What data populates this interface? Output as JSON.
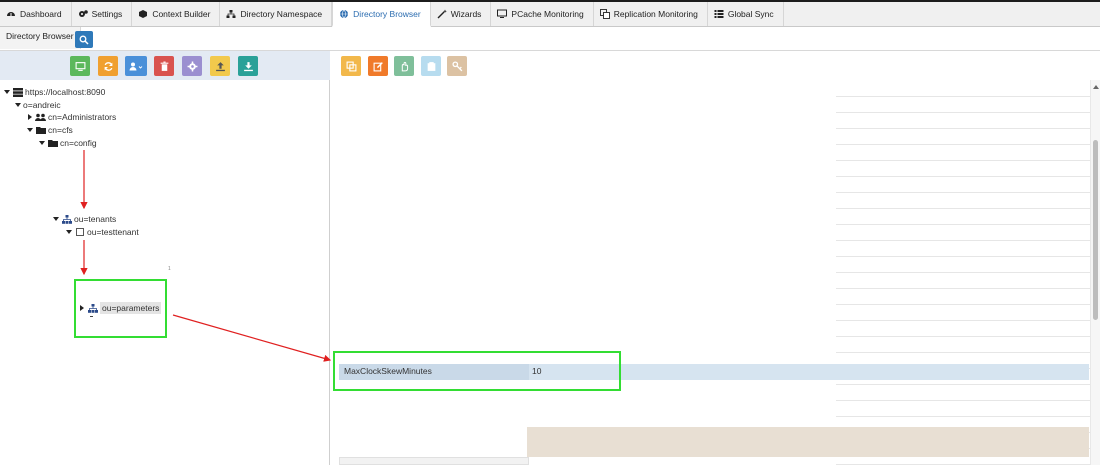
{
  "tabs": [
    {
      "label": "Dashboard",
      "icon": "dashboard-icon",
      "active": false
    },
    {
      "label": "Settings",
      "icon": "gears-icon",
      "active": false
    },
    {
      "label": "Context Builder",
      "icon": "cube-icon",
      "active": false
    },
    {
      "label": "Directory Namespace",
      "icon": "sitemap-icon",
      "active": false
    },
    {
      "label": "Directory Browser",
      "icon": "globe-icon",
      "active": true
    },
    {
      "label": "Wizards",
      "icon": "wand-icon",
      "active": false
    },
    {
      "label": "PCache Monitoring",
      "icon": "monitor-icon",
      "active": false
    },
    {
      "label": "Replication Monitoring",
      "icon": "replication-icon",
      "active": false
    },
    {
      "label": "Global Sync",
      "icon": "list-icon",
      "active": false
    }
  ],
  "subtab": {
    "label": "Directory Browser"
  },
  "left_toolbar": [
    {
      "name": "monitor-button",
      "color": "#5cb85c"
    },
    {
      "name": "refresh-button",
      "color": "#f0a030"
    },
    {
      "name": "add-user-button",
      "color": "#4a90d9"
    },
    {
      "name": "delete-button",
      "color": "#d9534f"
    },
    {
      "name": "settings-button",
      "color": "#9b8fd0"
    },
    {
      "name": "upload-button",
      "color": "#f2c94c"
    },
    {
      "name": "download-button",
      "color": "#2aa198"
    }
  ],
  "right_toolbar": [
    {
      "name": "copy-button",
      "color": "#f2b84b"
    },
    {
      "name": "edit-button",
      "color": "#f07a2a"
    },
    {
      "name": "hand-button",
      "color": "#7fbf9a"
    },
    {
      "name": "clipboard-button",
      "color": "#b7dcef"
    },
    {
      "name": "key-button",
      "color": "#dcc2a3"
    }
  ],
  "tree": {
    "root": "https://localhost:8090",
    "org": "o=andreic",
    "admins": "cn=Administrators",
    "cfs": "cn=cfs",
    "config": "cn=config",
    "tenants": "ou=tenants",
    "testtenant": "ou=testtenant",
    "parameters": "ou=parameters"
  },
  "tiny_mark": "1",
  "selected_row": {
    "key": "MaxClockSkewMinutes",
    "value": "10"
  },
  "colors": {
    "accent": "#2b6cb0",
    "highlight": "#33dd33",
    "arrow": "#e02020",
    "row": "#d6e4f0"
  }
}
